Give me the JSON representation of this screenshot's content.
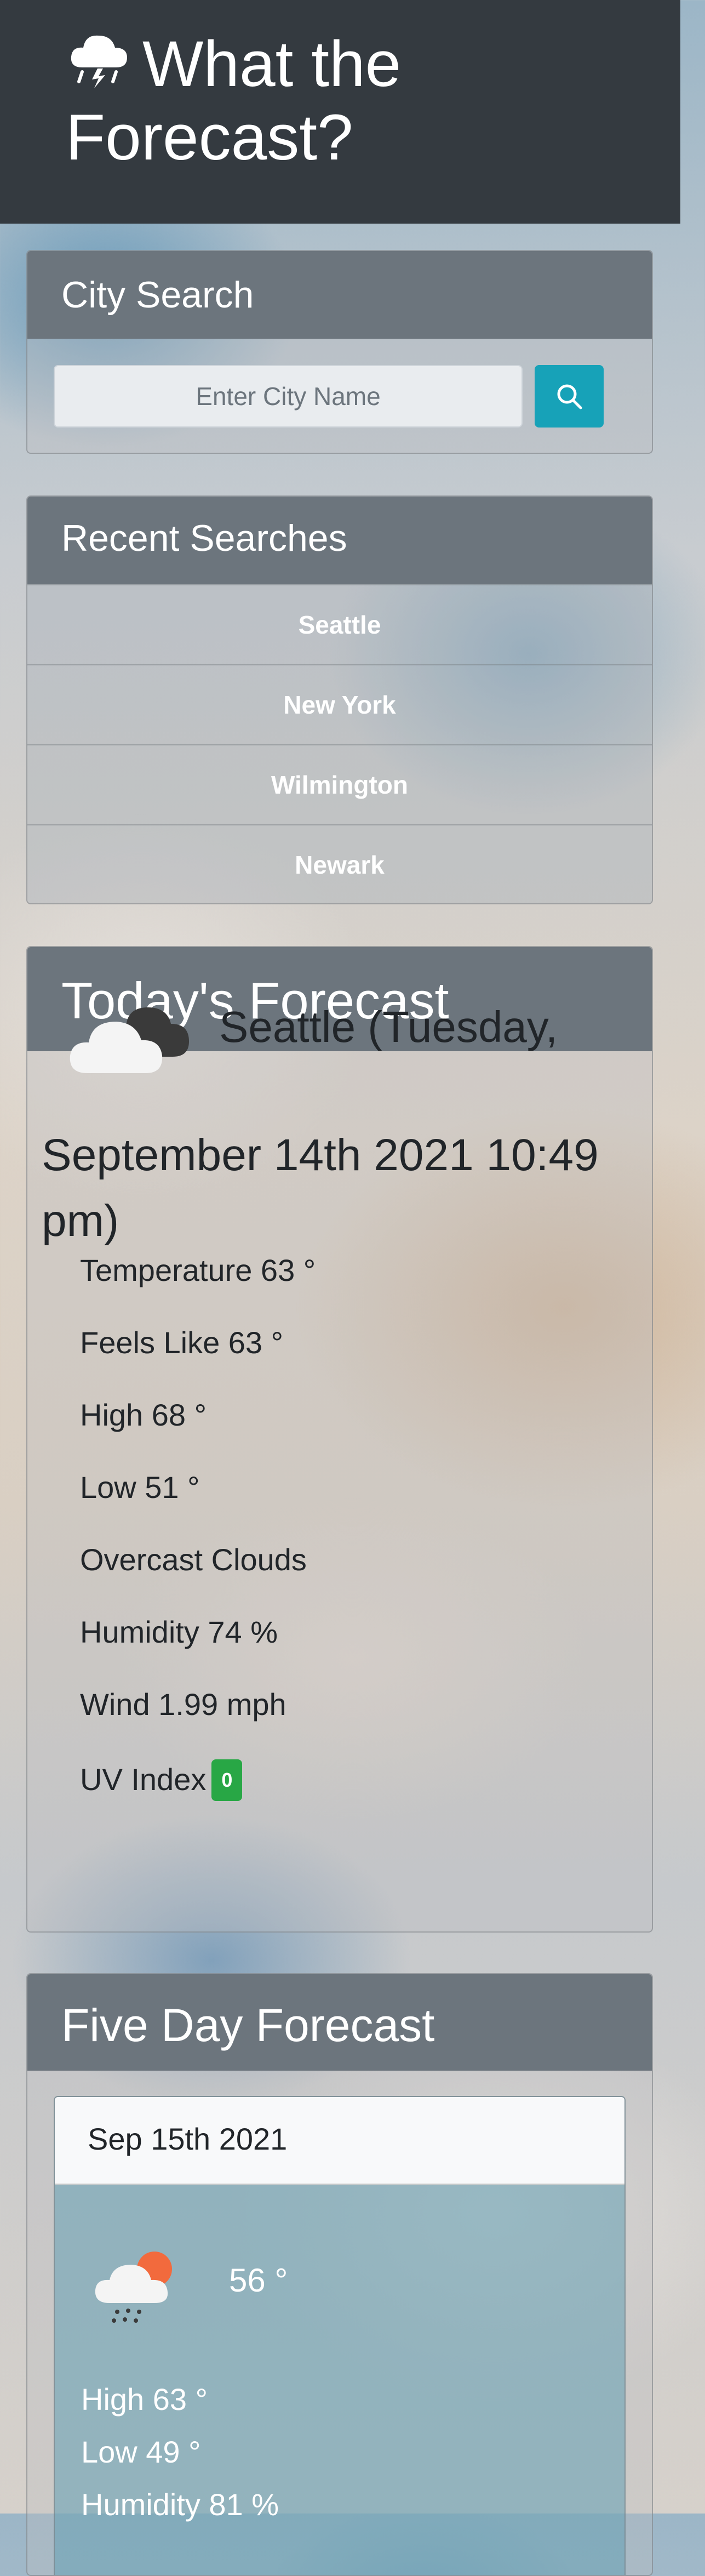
{
  "header": {
    "title": "What the Forecast?"
  },
  "city_search": {
    "title": "City Search",
    "placeholder": "Enter City Name"
  },
  "recent": {
    "title": "Recent Searches",
    "items": [
      "Seattle",
      "New York",
      "Wilmington",
      "Newark"
    ]
  },
  "today": {
    "title": "Today's Forecast",
    "city_line": "Seattle (Tuesday,",
    "date_line": "September 14th 2021 10:49 pm)",
    "temperature": "Temperature 63 °",
    "feels_like": "Feels Like 63 °",
    "high": "High 68 °",
    "low": "Low 51 °",
    "conditions": "Overcast Clouds",
    "humidity": "Humidity 74 %",
    "wind": "Wind 1.99 mph",
    "uv_label": "UV Index",
    "uv_value": "0",
    "icon": "overcast-clouds-icon"
  },
  "five_day": {
    "title": "Five Day Forecast",
    "days": [
      {
        "date": "Sep 15th 2021",
        "temp": "56 °",
        "high": "High 63 °",
        "low": "Low 49 °",
        "humidity": "Humidity 81 %",
        "icon": "sun-cloud-rain-icon"
      }
    ]
  },
  "colors": {
    "header_bg": "#343a40",
    "card_header_bg": "#6c757d",
    "search_button": "#17a2b8",
    "uv_badge": "#28a745"
  }
}
